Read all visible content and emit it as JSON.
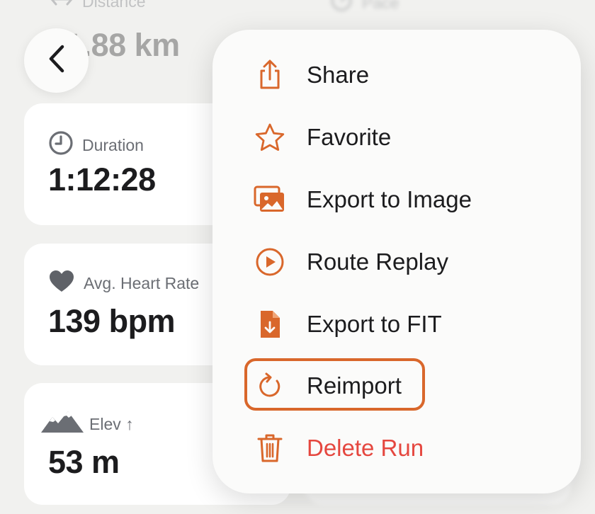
{
  "stats": {
    "distance": {
      "label": "Distance",
      "value": "11.88 km",
      "icon": "distance-arrows-icon"
    },
    "pace": {
      "label": "Pace",
      "icon": "speedometer-icon"
    },
    "duration": {
      "label": "Duration",
      "value": "1:12:28",
      "icon": "clock-icon"
    },
    "heart_rate": {
      "label": "Avg. Heart Rate",
      "value": "139 bpm",
      "icon": "heart-icon"
    },
    "elevation": {
      "label": "Elev ↑",
      "value": "53 m",
      "icon": "mountain-icon"
    }
  },
  "menu": {
    "items": [
      {
        "label": "Share",
        "icon": "share-icon"
      },
      {
        "label": "Favorite",
        "icon": "star-icon"
      },
      {
        "label": "Export to Image",
        "icon": "photos-icon"
      },
      {
        "label": "Route Replay",
        "icon": "play-circle-icon"
      },
      {
        "label": "Export to FIT",
        "icon": "file-download-icon"
      },
      {
        "label": "Reimport",
        "icon": "refresh-icon",
        "highlighted": true
      },
      {
        "label": "Delete Run",
        "icon": "trash-icon",
        "destructive": true
      }
    ]
  },
  "colors": {
    "accent": "#d9672b",
    "destructive": "#e5473f",
    "highlight_border": "#d9672b"
  }
}
